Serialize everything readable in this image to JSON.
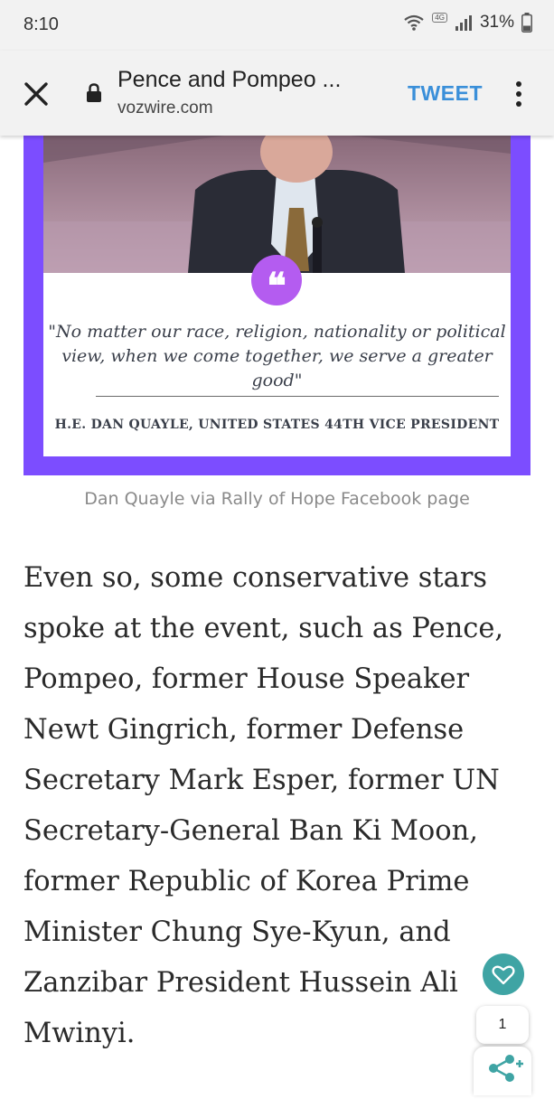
{
  "status_bar": {
    "time": "8:10",
    "network_badge": "4G",
    "battery": "31%"
  },
  "toolbar": {
    "page_title": "Pence and Pompeo ...",
    "domain": "vozwire.com",
    "tweet_label": "TWEET"
  },
  "image": {
    "quote": "\"No matter our race, religion, nationality or political view,  when we come together, we serve a greater good\"",
    "attribution": "H.E. DAN QUAYLE, UNITED STATES 44TH VICE PRESIDENT",
    "caption": "Dan Quayle via Rally of Hope Facebook page"
  },
  "article": {
    "paragraph": "Even so, some conservative stars spoke at the event, such as Pence, Pompeo, former House Speaker Newt Gingrich, former Defense Secretary Mark Esper, former UN Secretary-General Ban Ki Moon, former Republic of Korea Prime Minister Chung Sye-Kyun, and Zanzibar President Hussein Ali Mwinyi."
  },
  "floating_actions": {
    "like_count": "1"
  },
  "colors": {
    "frame_purple": "#7c4dff",
    "badge_purple": "#b45cf0",
    "tweet_blue": "#3a8fd9",
    "fab_teal": "#3fa4a4"
  }
}
